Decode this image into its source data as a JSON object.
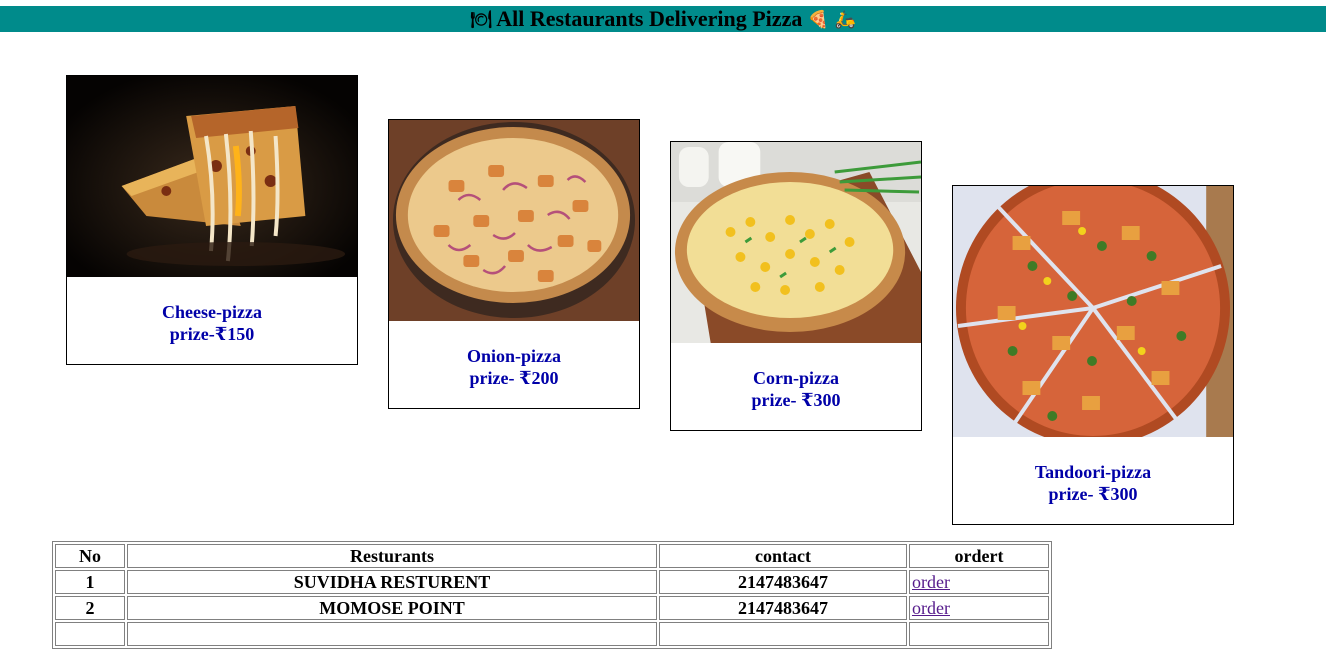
{
  "header": {
    "title": "All Restaurants Delivering Pizza",
    "left_icon": "fork-knife-plate-icon",
    "right_icons": [
      "pizza-slice-icon",
      "delivery-scooter-icon"
    ],
    "bg_color": "#008b8b"
  },
  "cards": [
    {
      "name": "Cheese-pizza",
      "price": "prize-₹150",
      "image": "cheese-pizza-photo"
    },
    {
      "name": "Onion-pizza",
      "price": "prize- ₹200",
      "image": "onion-pizza-photo"
    },
    {
      "name": "Corn-pizza",
      "price": "prize- ₹300",
      "image": "corn-pizza-photo"
    },
    {
      "name": "Tandoori-pizza",
      "price": "prize- ₹300",
      "image": "tandoori-pizza-photo"
    }
  ],
  "table": {
    "headers": {
      "no": "No",
      "restaurants": "Resturants",
      "contact": "contact",
      "order": "ordert"
    },
    "rows": [
      {
        "no": "1",
        "name": "SUVIDHA RESTURENT",
        "contact": "2147483647",
        "order": "order"
      },
      {
        "no": "2",
        "name": "MOMOSE POINT",
        "contact": "2147483647",
        "order": "order"
      },
      {
        "no": "",
        "name": "",
        "contact": "",
        "order": ""
      }
    ]
  }
}
